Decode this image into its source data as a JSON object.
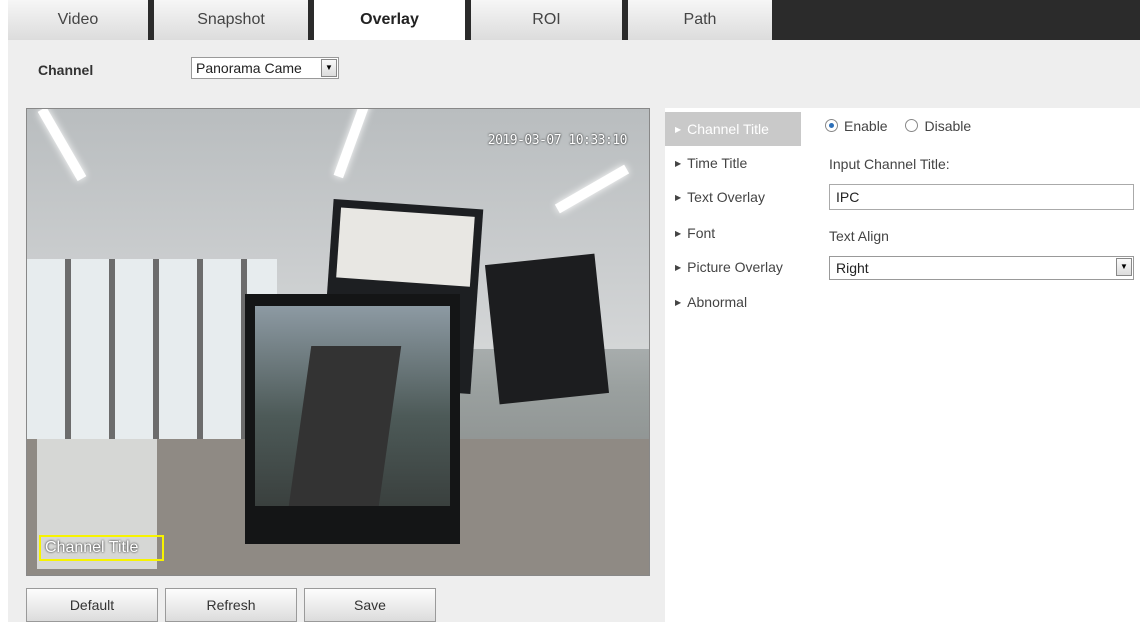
{
  "tabs": [
    {
      "label": "Video"
    },
    {
      "label": "Snapshot"
    },
    {
      "label": "Overlay"
    },
    {
      "label": "ROI"
    },
    {
      "label": "Path"
    }
  ],
  "active_tab": "Overlay",
  "channel": {
    "label": "Channel",
    "selected": "Panorama Came"
  },
  "video": {
    "timestamp": "2019-03-07 10:33:10",
    "overlay_text": "Channel Title"
  },
  "menu": {
    "items": [
      {
        "label": "Channel Title"
      },
      {
        "label": "Time Title"
      },
      {
        "label": "Text Overlay"
      },
      {
        "label": "Font"
      },
      {
        "label": "Picture Overlay"
      },
      {
        "label": "Abnormal"
      }
    ],
    "active": "Channel Title"
  },
  "panel": {
    "enable_label": "Enable",
    "disable_label": "Disable",
    "enabled": true,
    "input_title_label": "Input Channel Title:",
    "input_title_value": "IPC",
    "text_align_label": "Text Align",
    "text_align_value": "Right"
  },
  "buttons": {
    "default": "Default",
    "refresh": "Refresh",
    "save": "Save"
  },
  "colors": {
    "tab_bar": "#2b2b2b",
    "overlay_border": "#f7f300",
    "menu_active": "#c9c9c9",
    "radio_checked": "#2d6fb8"
  }
}
